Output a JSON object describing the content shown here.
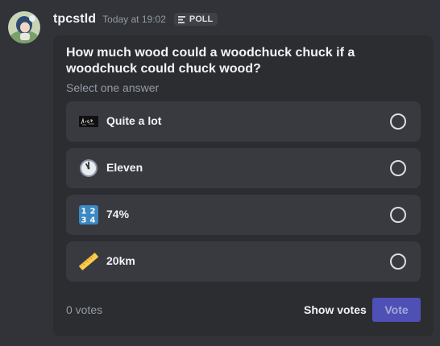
{
  "message": {
    "username": "tpcstld",
    "timestamp": "Today at 19:02",
    "badge_label": "POLL"
  },
  "poll": {
    "question": "How much wood could a woodchuck chuck if a woodchuck could chuck wood?",
    "instruction": "Select one answer",
    "answers": [
      {
        "label": "Quite a lot",
        "icon": "custom-image-icon"
      },
      {
        "label": "Eleven",
        "icon": "clock-eleven-icon"
      },
      {
        "label": "74%",
        "icon": "input-numbers-icon"
      },
      {
        "label": "20km",
        "icon": "straight-ruler-icon"
      }
    ],
    "votes_text": "0 votes",
    "show_votes_label": "Show votes",
    "vote_label": "Vote"
  },
  "colors": {
    "background": "#313338",
    "card": "#2b2d31",
    "answer_bg": "#383a40",
    "vote_button": "#4e50b6"
  }
}
